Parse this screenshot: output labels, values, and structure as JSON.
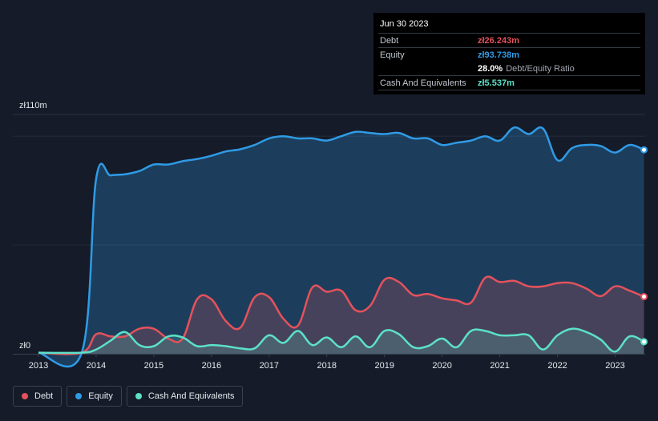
{
  "colors": {
    "debt": "#e4525c",
    "equity": "#2f9be6",
    "cash": "#5ce1c9",
    "background": "#151b28"
  },
  "tooltip": {
    "date": "Jun 30 2023",
    "debt_label": "Debt",
    "debt_value": "zł26.243m",
    "equity_label": "Equity",
    "equity_value": "zł93.738m",
    "ratio_value": "28.0%",
    "ratio_label": "Debt/Equity Ratio",
    "cash_label": "Cash And Equivalents",
    "cash_value": "zł5.537m"
  },
  "legend": [
    {
      "label": "Debt",
      "color": "#e4525c"
    },
    {
      "label": "Equity",
      "color": "#2f9be6"
    },
    {
      "label": "Cash And Equivalents",
      "color": "#5ce1c9"
    }
  ],
  "chart_data": {
    "type": "area",
    "y_top_label": "zł110m",
    "y_zero_label": "zł0",
    "ylim": [
      0,
      110
    ],
    "xlim": [
      2013,
      2023.5
    ],
    "x_ticks": [
      "2013",
      "2014",
      "2015",
      "2016",
      "2017",
      "2018",
      "2019",
      "2020",
      "2021",
      "2022",
      "2023"
    ],
    "legend_position": "bottom-left",
    "grid": true,
    "series": [
      {
        "name": "Equity",
        "points": [
          [
            2013.0,
            0.5
          ],
          [
            2013.75,
            0.5
          ],
          [
            2014.0,
            80.5
          ],
          [
            2014.25,
            82
          ],
          [
            2014.5,
            82.5
          ],
          [
            2014.75,
            84
          ],
          [
            2015.0,
            87
          ],
          [
            2015.25,
            87
          ],
          [
            2015.5,
            88.5
          ],
          [
            2015.75,
            89.5
          ],
          [
            2016.0,
            91
          ],
          [
            2016.25,
            93
          ],
          [
            2016.5,
            94
          ],
          [
            2016.75,
            96
          ],
          [
            2017.0,
            99
          ],
          [
            2017.25,
            100
          ],
          [
            2017.5,
            99
          ],
          [
            2017.75,
            99
          ],
          [
            2018.0,
            98
          ],
          [
            2018.25,
            100
          ],
          [
            2018.5,
            102
          ],
          [
            2018.75,
            101.5
          ],
          [
            2019.0,
            101
          ],
          [
            2019.25,
            101.5
          ],
          [
            2019.5,
            99
          ],
          [
            2019.75,
            99
          ],
          [
            2020.0,
            96
          ],
          [
            2020.25,
            97
          ],
          [
            2020.5,
            98
          ],
          [
            2020.75,
            100
          ],
          [
            2021.0,
            98
          ],
          [
            2021.25,
            104
          ],
          [
            2021.5,
            101
          ],
          [
            2021.75,
            103.5
          ],
          [
            2022.0,
            89
          ],
          [
            2022.25,
            94.5
          ],
          [
            2022.5,
            96
          ],
          [
            2022.75,
            95.5
          ],
          [
            2023.0,
            92.5
          ],
          [
            2023.25,
            96
          ],
          [
            2023.5,
            93.738
          ]
        ]
      },
      {
        "name": "Debt",
        "points": [
          [
            2013.0,
            0.5
          ],
          [
            2013.75,
            0.5
          ],
          [
            2014.0,
            9
          ],
          [
            2014.25,
            8
          ],
          [
            2014.5,
            8
          ],
          [
            2014.75,
            11.5
          ],
          [
            2015.0,
            11.5
          ],
          [
            2015.25,
            7
          ],
          [
            2015.5,
            7
          ],
          [
            2015.75,
            25
          ],
          [
            2016.0,
            25
          ],
          [
            2016.25,
            15
          ],
          [
            2016.5,
            12
          ],
          [
            2016.75,
            26
          ],
          [
            2017.0,
            26
          ],
          [
            2017.25,
            16
          ],
          [
            2017.5,
            13
          ],
          [
            2017.75,
            30.5
          ],
          [
            2018.0,
            28.5
          ],
          [
            2018.25,
            29
          ],
          [
            2018.5,
            20
          ],
          [
            2018.75,
            22
          ],
          [
            2019.0,
            34
          ],
          [
            2019.25,
            33
          ],
          [
            2019.5,
            27
          ],
          [
            2019.75,
            27.5
          ],
          [
            2020.0,
            25.5
          ],
          [
            2020.25,
            24.5
          ],
          [
            2020.5,
            23.5
          ],
          [
            2020.75,
            35
          ],
          [
            2021.0,
            33
          ],
          [
            2021.25,
            33.5
          ],
          [
            2021.5,
            31
          ],
          [
            2021.75,
            31
          ],
          [
            2022.0,
            32.5
          ],
          [
            2022.25,
            32.5
          ],
          [
            2022.5,
            30
          ],
          [
            2022.75,
            26.5
          ],
          [
            2023.0,
            31
          ],
          [
            2023.25,
            29
          ],
          [
            2023.5,
            26.243
          ]
        ]
      },
      {
        "name": "Cash And Equivalents",
        "points": [
          [
            2013.0,
            0.5
          ],
          [
            2013.75,
            0.5
          ],
          [
            2014.0,
            2
          ],
          [
            2014.25,
            6
          ],
          [
            2014.5,
            10
          ],
          [
            2014.75,
            4
          ],
          [
            2015.0,
            3.5
          ],
          [
            2015.25,
            8
          ],
          [
            2015.5,
            7.5
          ],
          [
            2015.75,
            3.5
          ],
          [
            2016.0,
            4
          ],
          [
            2016.25,
            3.5
          ],
          [
            2016.5,
            2.5
          ],
          [
            2016.75,
            2.5
          ],
          [
            2017.0,
            8.5
          ],
          [
            2017.25,
            5
          ],
          [
            2017.5,
            10.5
          ],
          [
            2017.75,
            4
          ],
          [
            2018.0,
            7.5
          ],
          [
            2018.25,
            3
          ],
          [
            2018.5,
            8
          ],
          [
            2018.75,
            3
          ],
          [
            2019.0,
            10.5
          ],
          [
            2019.25,
            9
          ],
          [
            2019.5,
            3
          ],
          [
            2019.75,
            3.5
          ],
          [
            2020.0,
            7
          ],
          [
            2020.25,
            3
          ],
          [
            2020.5,
            10.5
          ],
          [
            2020.75,
            10.5
          ],
          [
            2021.0,
            8.5
          ],
          [
            2021.25,
            8.5
          ],
          [
            2021.5,
            8.5
          ],
          [
            2021.75,
            2
          ],
          [
            2022.0,
            8.5
          ],
          [
            2022.25,
            11.5
          ],
          [
            2022.5,
            10
          ],
          [
            2022.75,
            6.5
          ],
          [
            2023.0,
            1
          ],
          [
            2023.25,
            8
          ],
          [
            2023.5,
            5.537
          ]
        ]
      }
    ]
  }
}
